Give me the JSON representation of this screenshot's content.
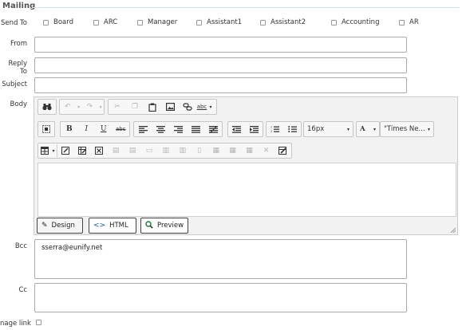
{
  "section": {
    "title": "Mailing"
  },
  "send_to": {
    "label": "Send To",
    "options": [
      "Board",
      "ARC",
      "Manager",
      "Assistant1",
      "Assistant2",
      "Accounting",
      "AR"
    ]
  },
  "fields": {
    "from": {
      "label": "From",
      "value": ""
    },
    "reply_to": {
      "label": "Reply To",
      "value": ""
    },
    "subject": {
      "label": "Subject",
      "value": ""
    },
    "body": {
      "label": "Body"
    },
    "bcc": {
      "label": "Bcc",
      "value": "sserra@eunify.net"
    },
    "cc": {
      "label": "Cc",
      "value": ""
    },
    "image_link": {
      "label": "nage link"
    }
  },
  "editor": {
    "font_size": "16px",
    "font_name": "\"Times Ne...",
    "modes": {
      "design": "Design",
      "html": "HTML",
      "preview": "Preview"
    }
  },
  "icons": {
    "find": "binoculars-icon",
    "undo": "undo-icon",
    "redo": "redo-icon",
    "cut": "cut-icon",
    "copy": "copy-icon",
    "paste": "paste-icon",
    "image": "image-icon",
    "link": "link-icon",
    "spell": "spellcheck-icon",
    "bold": "B",
    "italic": "I",
    "underline": "U",
    "strike": "abc",
    "align_left": "align-left-icon",
    "align_center": "align-center-icon",
    "align_right": "align-right-icon",
    "justify": "justify-icon",
    "indent": "indent-icon",
    "outdent": "outdent-icon",
    "ordered_list": "ordered-list-icon",
    "bullet_list": "bullet-list-icon"
  }
}
